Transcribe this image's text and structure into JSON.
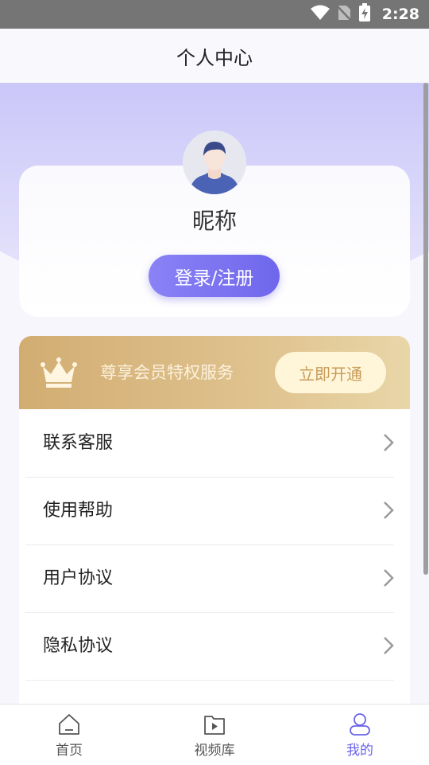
{
  "status_bar": {
    "time": "2:28"
  },
  "header": {
    "title": "个人中心"
  },
  "profile": {
    "nickname": "昵称",
    "login_label": "登录/注册"
  },
  "vip": {
    "text": "尊享会员特权服务",
    "button_label": "立即开通"
  },
  "menu": {
    "items": [
      {
        "label": "联系客服"
      },
      {
        "label": "使用帮助"
      },
      {
        "label": "用户协议"
      },
      {
        "label": "隐私协议"
      }
    ]
  },
  "bottom_nav": {
    "items": [
      {
        "label": "首页",
        "icon": "home-icon",
        "active": false
      },
      {
        "label": "视频库",
        "icon": "video-library-icon",
        "active": false
      },
      {
        "label": "我的",
        "icon": "profile-icon",
        "active": true
      }
    ]
  },
  "colors": {
    "accent": "#6b63e8",
    "hero_gradient_top": "#8c86f6",
    "vip_gold": "#d2ad72",
    "vip_button_text": "#c79b57"
  }
}
